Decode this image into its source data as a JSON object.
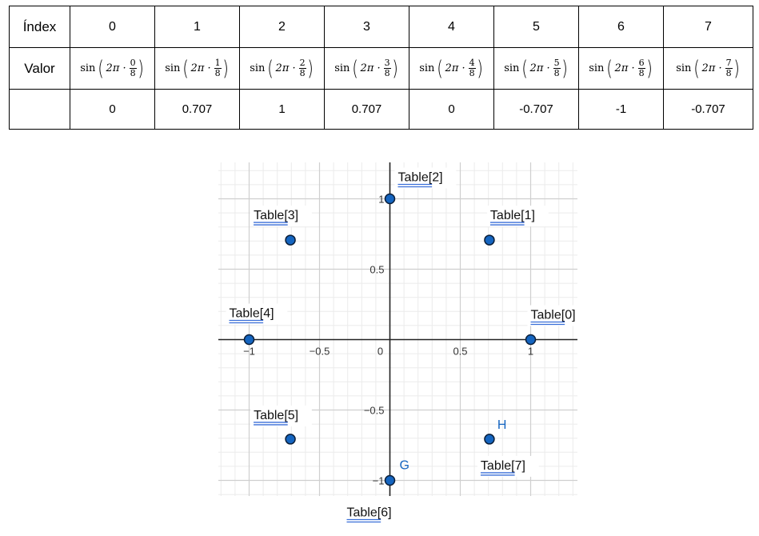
{
  "table": {
    "header_label": "Índex",
    "value_label": "Valor",
    "indices": [
      "0",
      "1",
      "2",
      "3",
      "4",
      "5",
      "6",
      "7"
    ],
    "formula": {
      "fn": "sin",
      "coef": "2π ·",
      "denominator": "8",
      "numerators": [
        "0",
        "1",
        "2",
        "3",
        "4",
        "5",
        "6",
        "7"
      ]
    },
    "results": [
      "0",
      "0.707",
      "1",
      "0.707",
      "0",
      "-0.707",
      "-1",
      "-0.707"
    ]
  },
  "chart_data": {
    "type": "scatter",
    "xlim": [
      -1.22,
      1.32
    ],
    "ylim": [
      -1.1,
      1.26
    ],
    "x_ticks": [
      -1,
      -0.5,
      0,
      0.5,
      1
    ],
    "x_tick_labels": [
      "−1",
      "−0.5",
      "0",
      "0.5",
      "1"
    ],
    "y_ticks": [
      -1,
      -0.5,
      0.5,
      1
    ],
    "y_tick_labels": [
      "−1",
      "−0.5",
      "0.5",
      "1"
    ],
    "grid": true,
    "point_color": "#1565c0",
    "points": [
      {
        "label": "Table[0]",
        "x": 1,
        "y": 0
      },
      {
        "label": "Table[1]",
        "x": 0.707,
        "y": 0.707
      },
      {
        "label": "Table[2]",
        "x": 0,
        "y": 1
      },
      {
        "label": "Table[3]",
        "x": -0.707,
        "y": 0.707
      },
      {
        "label": "Table[4]",
        "x": -1,
        "y": 0
      },
      {
        "label": "Table[5]",
        "x": -0.707,
        "y": -0.707
      },
      {
        "label": "Table[6]",
        "x": 0,
        "y": -1,
        "name": "G"
      },
      {
        "label": "Table[7]",
        "x": 0.707,
        "y": -0.707,
        "name": "H"
      }
    ]
  }
}
